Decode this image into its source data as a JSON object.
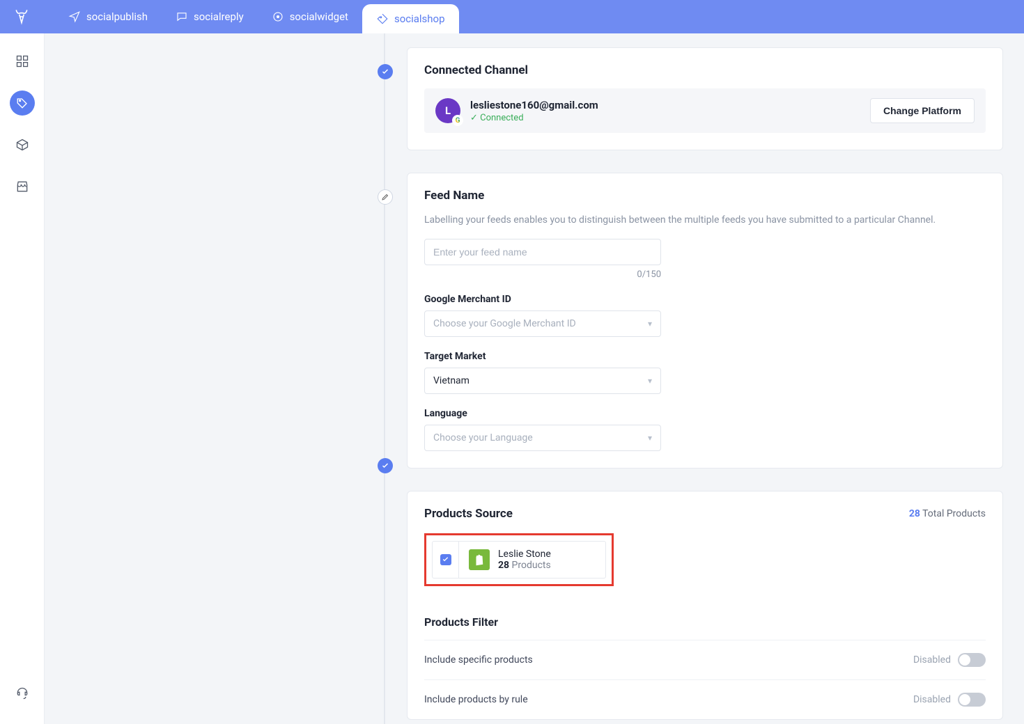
{
  "topnav": {
    "items": [
      {
        "label": "socialpublish"
      },
      {
        "label": "socialreply"
      },
      {
        "label": "socialwidget"
      },
      {
        "label": "socialshop"
      }
    ]
  },
  "connected": {
    "heading": "Connected Channel",
    "email": "lesliestone160@gmail.com",
    "status": "Connected",
    "avatar_letter": "L",
    "change_label": "Change Platform"
  },
  "feed": {
    "heading": "Feed Name",
    "desc": "Labelling your feeds enables you to distinguish between the multiple feeds you have submitted to a particular Channel.",
    "placeholder": "Enter your feed name",
    "counter": "0/150",
    "merchant_label": "Google Merchant ID",
    "merchant_placeholder": "Choose your Google Merchant ID",
    "market_label": "Target Market",
    "market_value": "Vietnam",
    "lang_label": "Language",
    "lang_placeholder": "Choose your Language"
  },
  "products": {
    "heading": "Products Source",
    "total_count": "28",
    "total_label": " Total Products",
    "source_name": "Leslie Stone",
    "source_count": "28",
    "source_unit": " Products",
    "filter_heading": "Products Filter",
    "filter1_label": "Include specific products",
    "filter2_label": "Include products by rule",
    "disabled_label": "Disabled"
  }
}
